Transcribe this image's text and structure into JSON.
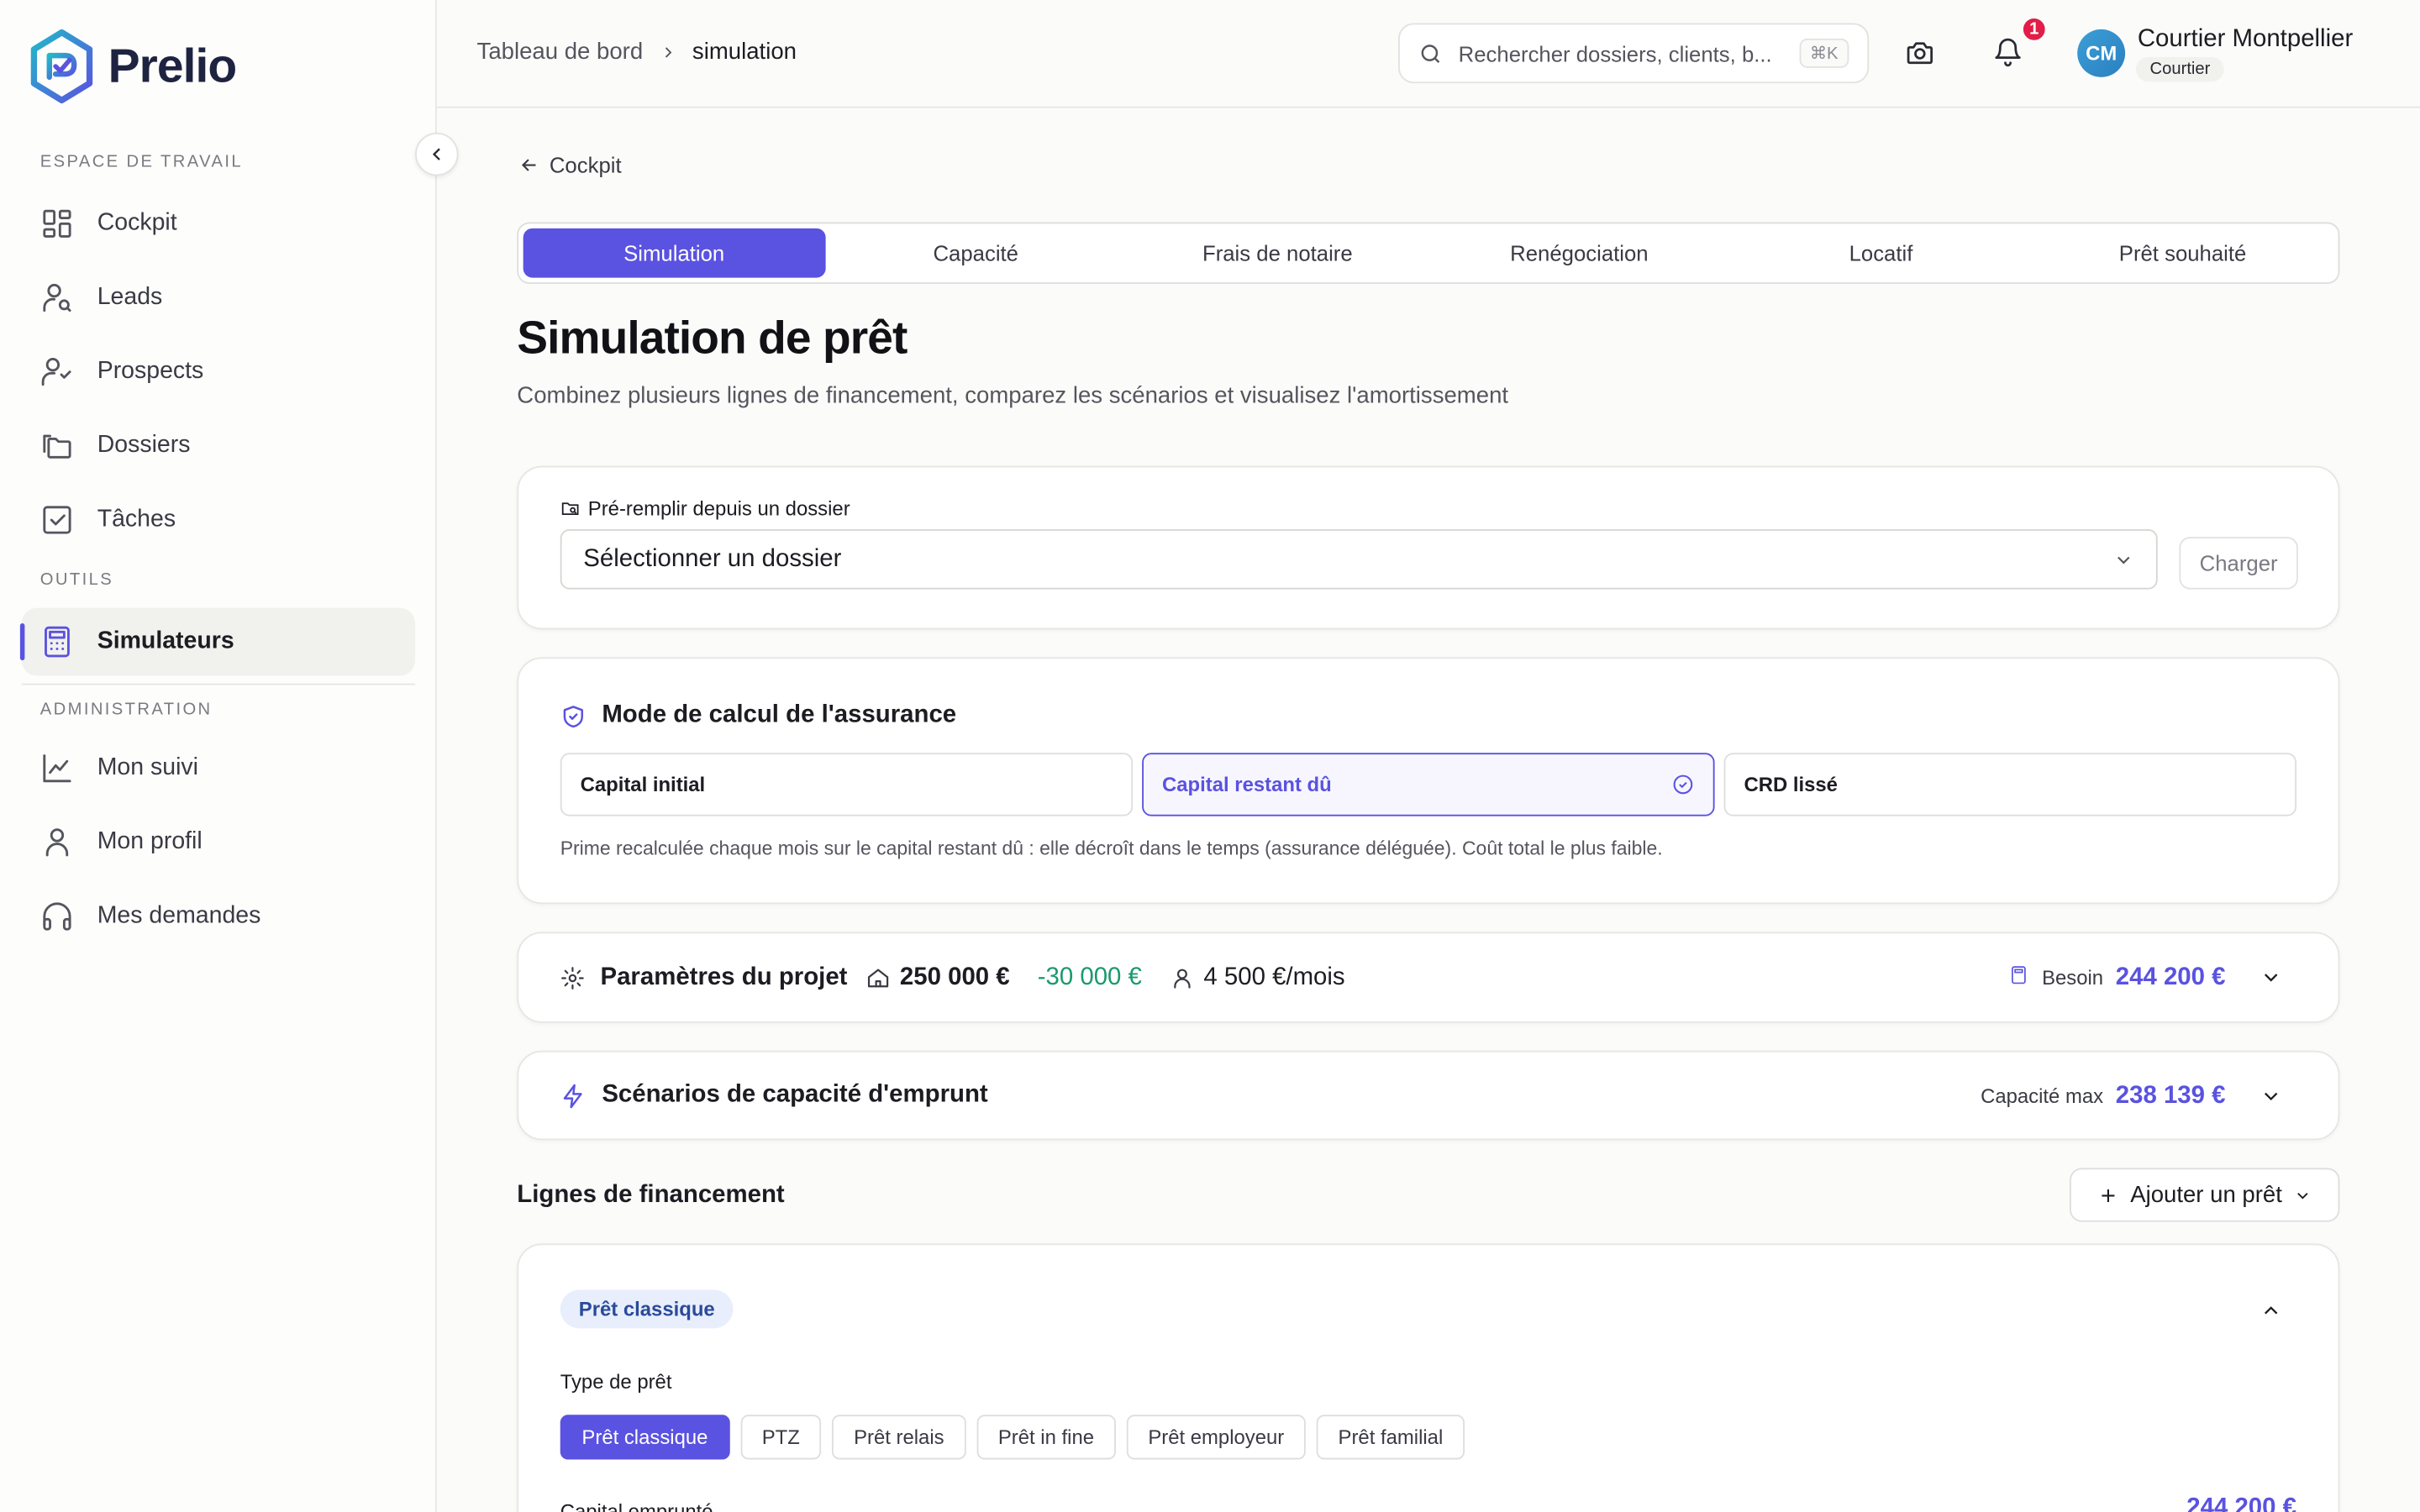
{
  "brand": {
    "name": "Prelio",
    "accent": "#5a52e0"
  },
  "sidebar": {
    "sections": {
      "workspace": "ESPACE DE TRAVAIL",
      "tools": "OUTILS",
      "admin": "ADMINISTRATION"
    },
    "items": [
      {
        "label": "Cockpit",
        "icon": "grid-icon"
      },
      {
        "label": "Leads",
        "icon": "user-search-icon"
      },
      {
        "label": "Prospects",
        "icon": "user-check-icon"
      },
      {
        "label": "Dossiers",
        "icon": "folders-icon"
      },
      {
        "label": "Tâches",
        "icon": "checkbox-icon"
      },
      {
        "label": "Simulateurs",
        "icon": "calculator-icon",
        "active": true
      },
      {
        "label": "Mon suivi",
        "icon": "chart-line-icon"
      },
      {
        "label": "Mon profil",
        "icon": "user-icon"
      },
      {
        "label": "Mes demandes",
        "icon": "headphones-icon"
      }
    ]
  },
  "header": {
    "breadcrumb": {
      "parent": "Tableau de bord",
      "current": "simulation"
    },
    "search": {
      "placeholder": "Rechercher dossiers, clients, b...",
      "shortcut": "⌘K"
    },
    "notifications_count": "1",
    "user": {
      "initials": "CM",
      "name": "Courtier Montpellier",
      "role": "Courtier"
    }
  },
  "main": {
    "back_label": "Cockpit",
    "tabs": [
      {
        "label": "Simulation",
        "active": true
      },
      {
        "label": "Capacité"
      },
      {
        "label": "Frais de notaire"
      },
      {
        "label": "Renégociation"
      },
      {
        "label": "Locatif"
      },
      {
        "label": "Prêt souhaité"
      }
    ],
    "title": "Simulation de prêt",
    "subtitle": "Combinez plusieurs lignes de financement, comparez les scénarios et visualisez l'amortissement",
    "prefill": {
      "label": "Pré-remplir depuis un dossier",
      "select_value": "Sélectionner un dossier",
      "button": "Charger"
    },
    "insurance": {
      "title": "Mode de calcul de l'assurance",
      "options": [
        {
          "label": "Capital initial"
        },
        {
          "label": "Capital restant dû",
          "selected": true
        },
        {
          "label": "CRD lissé"
        }
      ],
      "note": "Prime recalculée chaque mois sur le capital restant dû : elle décroît dans le temps (assurance déléguée). Coût total le plus faible."
    },
    "params": {
      "title": "Paramètres du projet",
      "price": "250 000 €",
      "contribution": "-30 000 €",
      "income": "4 500 €/mois",
      "need_label": "Besoin",
      "need_value": "244 200 €"
    },
    "scenarios": {
      "title": "Scénarios de capacité d'emprunt",
      "max_label": "Capacité max",
      "max_value": "238 139 €"
    },
    "financing": {
      "title": "Lignes de financement",
      "add_button": "Ajouter un prêt",
      "loan": {
        "pill": "Prêt classique",
        "type_label": "Type de prêt",
        "types": [
          {
            "label": "Prêt classique",
            "active": true
          },
          {
            "label": "PTZ"
          },
          {
            "label": "Prêt relais"
          },
          {
            "label": "Prêt in fine"
          },
          {
            "label": "Prêt employeur"
          },
          {
            "label": "Prêt familial"
          }
        ],
        "capital_label": "Capital emprunté",
        "capital_value": "244 200 €"
      }
    }
  }
}
